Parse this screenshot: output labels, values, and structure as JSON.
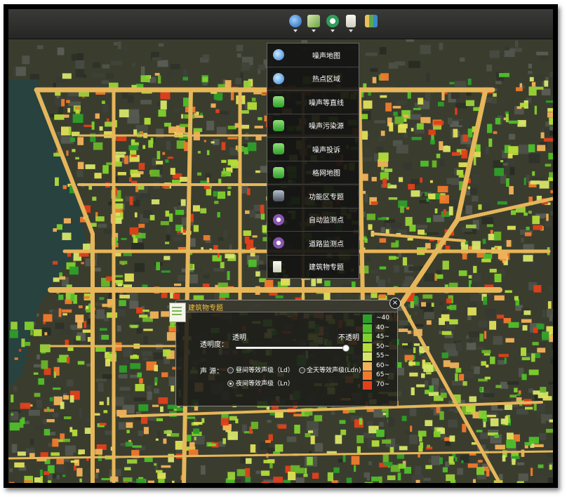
{
  "toolbar": {
    "icons": [
      "globe-pin-icon",
      "map-pencil-icon",
      "layers-icon",
      "document-icon",
      "map-icon"
    ]
  },
  "menu": {
    "items": [
      {
        "label": "噪声地图",
        "icon": "globe-icon",
        "color": "#2a7fd4"
      },
      {
        "label": "热点区域",
        "icon": "globe-icon",
        "color": "#2a7fd4"
      },
      {
        "label": "噪声等直线",
        "icon": "contour-icon",
        "color": "#3fae2a"
      },
      {
        "label": "噪声污染源",
        "icon": "source-icon",
        "color": "#3fae2a"
      },
      {
        "label": "噪声投诉",
        "icon": "complaint-icon",
        "color": "#3fae2a"
      },
      {
        "label": "格网地图",
        "icon": "grid-icon",
        "color": "#3fae2a"
      },
      {
        "label": "功能区专题",
        "icon": "zone-icon",
        "color": "#6a7080"
      },
      {
        "label": "自动监测点",
        "icon": "monitor-icon",
        "color": "#8a55b0"
      },
      {
        "label": "道路监测点",
        "icon": "monitor-icon",
        "color": "#8a55b0"
      },
      {
        "label": "建筑物专题",
        "icon": "building-doc-icon",
        "color": "#dcdcd0"
      }
    ]
  },
  "panel": {
    "title": "建筑物专题",
    "opacity_label": "透明度：",
    "transparent_label": "透明",
    "opaque_label": "不透明",
    "opacity_value": 1.0,
    "source_label": "声 源：",
    "options": [
      {
        "label": "昼间等效声级（Ld）",
        "selected": false
      },
      {
        "label": "全天等效声级(Ldn)",
        "selected": false
      },
      {
        "label": "夜间等效声级（Ln）",
        "selected": true
      }
    ],
    "close": "×",
    "legend": [
      {
        "label": "~40",
        "color": "#2e9e2a"
      },
      {
        "label": "40~",
        "color": "#4fbf2a"
      },
      {
        "label": "45~",
        "color": "#7fd12d"
      },
      {
        "label": "50~",
        "color": "#b4dd3a"
      },
      {
        "label": "55~",
        "color": "#d7e66a"
      },
      {
        "label": "60~",
        "color": "#f2b25a"
      },
      {
        "label": "65~",
        "color": "#f07a2c"
      },
      {
        "label": "70~",
        "color": "#e2401a"
      }
    ]
  }
}
